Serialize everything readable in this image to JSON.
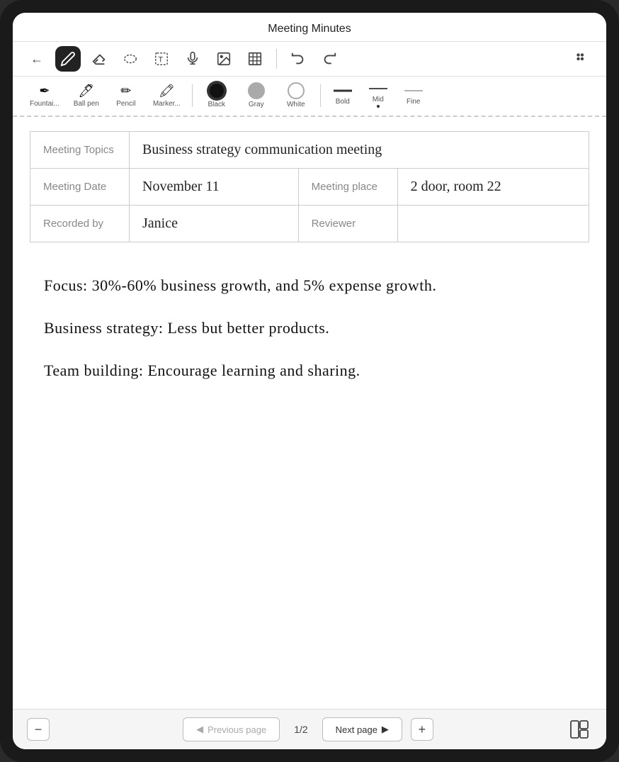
{
  "app": {
    "title": "Meeting Minutes"
  },
  "toolbar": {
    "back_label": "←",
    "tools": [
      {
        "id": "pen",
        "label": "✒",
        "active": true
      },
      {
        "id": "eraser",
        "label": "⬡"
      },
      {
        "id": "lasso",
        "label": "⬭"
      },
      {
        "id": "text",
        "label": "T"
      },
      {
        "id": "mic",
        "label": "🎤"
      },
      {
        "id": "image",
        "label": "🖼"
      },
      {
        "id": "table",
        "label": "⊞"
      },
      {
        "id": "undo",
        "label": "↩"
      },
      {
        "id": "redo",
        "label": "↪"
      },
      {
        "id": "more",
        "label": "⋮⋮"
      }
    ]
  },
  "sub_toolbar": {
    "pen_types": [
      {
        "id": "fountain",
        "label": "Fountai..."
      },
      {
        "id": "ballpen",
        "label": "Ball pen"
      },
      {
        "id": "pencil",
        "label": "Pencil"
      },
      {
        "id": "marker",
        "label": "Marker..."
      }
    ],
    "colors": [
      {
        "id": "black",
        "label": "Black",
        "selected": true
      },
      {
        "id": "gray",
        "label": "Gray"
      },
      {
        "id": "white",
        "label": "White"
      }
    ],
    "strokes": [
      {
        "id": "bold",
        "label": "Bold"
      },
      {
        "id": "mid",
        "label": "Mid"
      },
      {
        "id": "fine",
        "label": "Fine"
      }
    ]
  },
  "table": {
    "rows": [
      {
        "col1_label": "Meeting Topics",
        "col1_value": "Business strategy communication meeting",
        "colspan": true
      },
      {
        "col1_label": "Meeting Date",
        "col1_value": "November 11",
        "col2_label": "Meeting place",
        "col2_value": "2 door, room 22"
      },
      {
        "col1_label": "Recorded by",
        "col1_value": "Janice",
        "col2_label": "Reviewer",
        "col2_value": ""
      }
    ]
  },
  "notes": [
    {
      "text": "Focus: 30%-60% business growth, and 5% expense growth."
    },
    {
      "text": "Business strategy: Less but better products."
    },
    {
      "text": "Team building: Encourage learning and sharing."
    }
  ],
  "bottom_bar": {
    "minus_label": "−",
    "prev_label": "Previous page",
    "page_indicator": "1/2",
    "next_label": "Next page",
    "add_label": "+"
  }
}
